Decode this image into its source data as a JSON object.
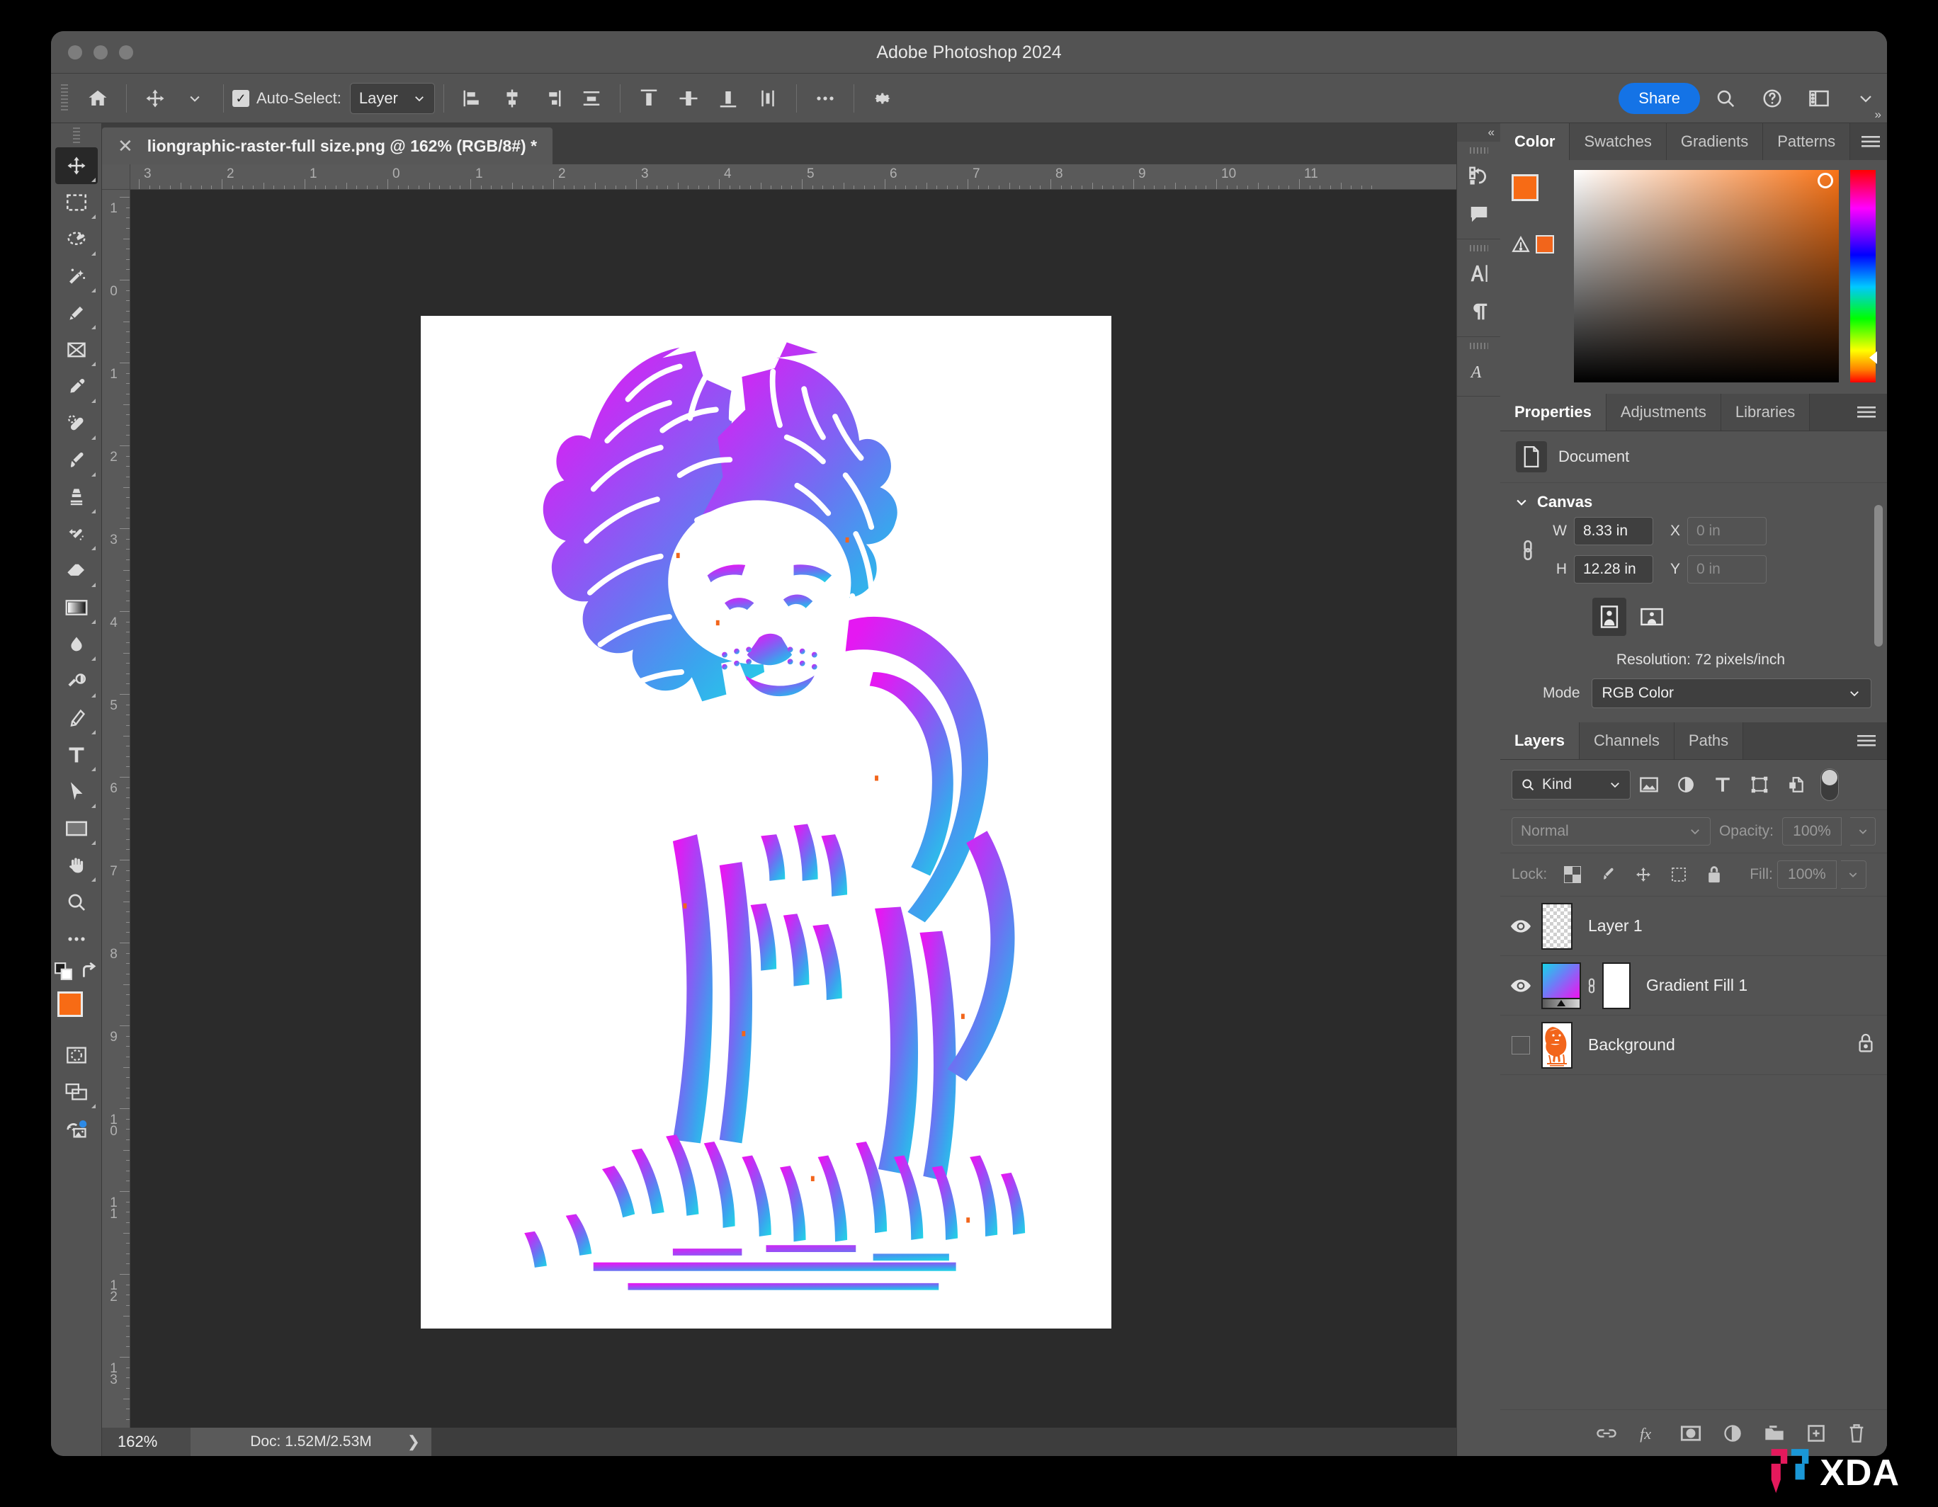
{
  "window": {
    "title": "Adobe Photoshop 2024"
  },
  "options_bar": {
    "home_icon": "home-icon",
    "tool_icon": "move-tool-icon",
    "autoselect_label": "Auto-Select:",
    "autoselect_checked": true,
    "autoselect_value": "Layer",
    "align_icons": [
      "align-left-icon",
      "align-horizontal-center-icon",
      "align-right-icon",
      "distribute-horizontal-icon",
      "align-top-icon",
      "align-vertical-center-icon",
      "align-bottom-icon",
      "distribute-vertical-icon"
    ],
    "more_icon": "ellipsis-icon",
    "settings_icon": "gear-icon",
    "share_label": "Share",
    "search_icon": "search-icon",
    "help_icon": "help-icon",
    "workspace_icon": "workspace-icon",
    "chevron_icon": "chevron-down-icon"
  },
  "toolbar": {
    "tools": [
      {
        "name": "move-tool",
        "selected": true
      },
      {
        "name": "rectangular-marquee-tool",
        "selected": false
      },
      {
        "name": "lasso-tool",
        "selected": false
      },
      {
        "name": "object-selection-tool",
        "selected": false
      },
      {
        "name": "quick-selection-tool",
        "selected": false
      },
      {
        "name": "crop-tool",
        "selected": false
      },
      {
        "name": "eyedropper-tool",
        "selected": false
      },
      {
        "name": "healing-brush-tool",
        "selected": false
      },
      {
        "name": "brush-tool",
        "selected": false
      },
      {
        "name": "clone-stamp-tool",
        "selected": false
      },
      {
        "name": "history-brush-tool",
        "selected": false
      },
      {
        "name": "eraser-tool",
        "selected": false
      },
      {
        "name": "gradient-tool",
        "selected": false
      },
      {
        "name": "blur-tool",
        "selected": false
      },
      {
        "name": "dodge-tool",
        "selected": false
      },
      {
        "name": "pen-tool",
        "selected": false
      },
      {
        "name": "type-tool",
        "selected": false
      },
      {
        "name": "path-selection-tool",
        "selected": false
      },
      {
        "name": "rectangle-tool",
        "selected": false
      },
      {
        "name": "hand-tool",
        "selected": false
      },
      {
        "name": "zoom-tool",
        "selected": false
      },
      {
        "name": "edit-toolbar",
        "selected": false
      }
    ],
    "foreground_color": "#F76B15",
    "background_color": "#0C6B45",
    "swap_icon": "swap-colors-icon",
    "default_colors_icon": "default-colors-icon",
    "quick_mask_icon": "quick-mask-icon",
    "screen_mode_icon": "screen-mode-icon",
    "generative_icon": "generative-fill-icon"
  },
  "document": {
    "tab_title": "liongraphic-raster-full size.png @ 162% (RGB/8#) *",
    "close_icon": "close-icon",
    "h_ruler_labels": [
      "3",
      "2",
      "1",
      "0",
      "1",
      "2",
      "3",
      "4",
      "5",
      "6",
      "7",
      "8",
      "9",
      "10",
      "11"
    ],
    "v_ruler_labels": [
      "1",
      "0",
      "1",
      "2",
      "3",
      "4",
      "5",
      "6",
      "7",
      "8",
      "9",
      "10",
      "11",
      "12",
      "13"
    ],
    "artwork_name": "lion-line-art-gradient",
    "gradient_colors": [
      "#e518f2",
      "#9b4df5",
      "#5a7bf0",
      "#3aa5ee",
      "#22d3e6"
    ]
  },
  "status_bar": {
    "zoom_level": "162%",
    "doc_info": "Doc: 1.52M/2.53M",
    "expand_icon": "chevron-right-icon"
  },
  "icon_rail": {
    "collapse_icon": "double-chevron-left-icon",
    "groups": [
      [
        "history-icon",
        "comments-icon"
      ],
      [
        "character-icon",
        "paragraph-icon"
      ],
      [
        "glyphs-icon"
      ]
    ]
  },
  "color_panel": {
    "tabs": [
      "Color",
      "Swatches",
      "Gradients",
      "Patterns"
    ],
    "active_tab": "Color",
    "menu_icon": "panel-menu-icon",
    "foreground_color": "#F76B15",
    "background_color": "#0C6B45",
    "warning_icon": "out-of-gamut-warning-icon",
    "warning_swatch_color": "#F2651B"
  },
  "properties_panel": {
    "tabs": [
      "Properties",
      "Adjustments",
      "Libraries"
    ],
    "active_tab": "Properties",
    "menu_icon": "panel-menu-icon",
    "doc_icon": "document-icon",
    "doc_label": "Document",
    "section_title": "Canvas",
    "collapse_icon": "chevron-down-icon",
    "link_icon": "link-dimensions-icon",
    "w_label": "W",
    "w_value": "8.33 in",
    "h_label": "H",
    "h_value": "12.28 in",
    "x_label": "X",
    "x_placeholder": "0 in",
    "y_label": "Y",
    "y_placeholder": "0 in",
    "portrait_icon": "portrait-orientation-icon",
    "landscape_icon": "landscape-orientation-icon",
    "orientation_selected": "portrait",
    "resolution": "Resolution: 72 pixels/inch",
    "mode_label": "Mode",
    "mode_value": "RGB Color"
  },
  "layers_panel": {
    "tabs": [
      "Layers",
      "Channels",
      "Paths"
    ],
    "active_tab": "Layers",
    "menu_icon": "panel-menu-icon",
    "filter_label": "Kind",
    "filter_search_icon": "search-icon",
    "filter_icons": [
      "filter-pixel-icon",
      "filter-adjustment-icon",
      "filter-type-icon",
      "filter-shape-icon",
      "filter-smartobject-icon"
    ],
    "filter_toggle": "filter-enable-toggle",
    "blend_mode": "Normal",
    "opacity_label": "Opacity:",
    "opacity_value": "100%",
    "lock_label": "Lock:",
    "lock_icons": [
      "lock-transparent-pixels-icon",
      "lock-image-pixels-icon",
      "lock-position-icon",
      "lock-artboard-icon",
      "lock-all-icon"
    ],
    "fill_label": "Fill:",
    "fill_value": "100%",
    "layers": [
      {
        "name": "Layer 1",
        "visible": true,
        "thumb": "checker",
        "locked": false
      },
      {
        "name": "Gradient Fill 1",
        "visible": true,
        "thumb": "gradient",
        "locked": false,
        "has_mask": true
      },
      {
        "name": "Background",
        "visible": false,
        "thumb": "lion",
        "locked": true
      }
    ],
    "bottom_icons": [
      "link-layers-icon",
      "layer-style-fx-icon",
      "add-mask-icon",
      "new-adjustment-layer-icon",
      "new-group-icon",
      "new-layer-icon",
      "delete-layer-icon"
    ]
  },
  "watermark": {
    "text": "XDA",
    "logo": "xda-logo-icon"
  }
}
